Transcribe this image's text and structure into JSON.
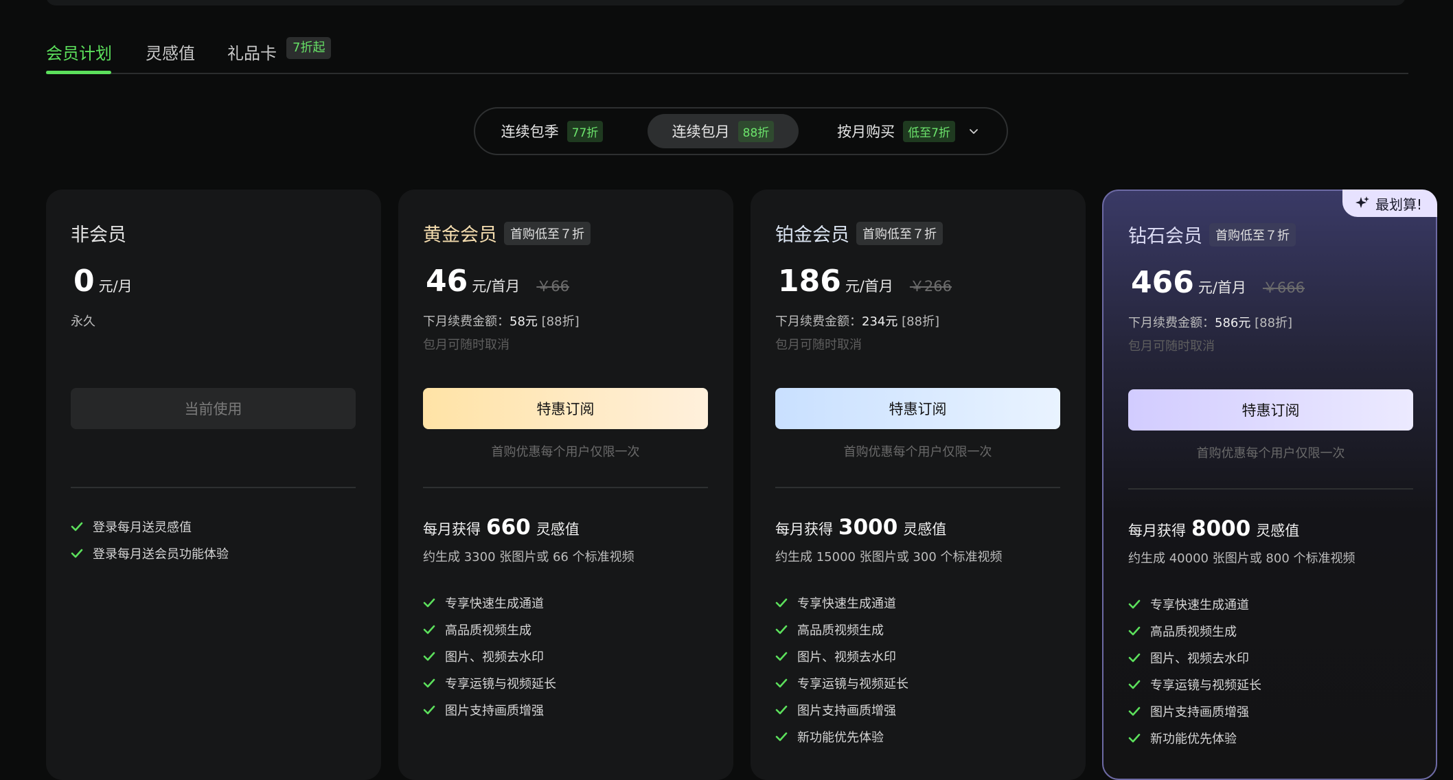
{
  "tabs": [
    {
      "label": "会员计划"
    },
    {
      "label": "灵感值"
    },
    {
      "label": "礼品卡",
      "badge": "7折起"
    }
  ],
  "billing": [
    {
      "label": "连续包季",
      "badge": "77折"
    },
    {
      "label": "连续包月",
      "badge": "88折"
    },
    {
      "label": "按月购买",
      "badge": "低至7折"
    }
  ],
  "plans": [
    {
      "name": "非会员",
      "price": "0",
      "unit": "元/月",
      "period": "永久",
      "button": "当前使用",
      "features": [
        "登录每月送灵感值",
        "登录每月送会员功能体验"
      ]
    },
    {
      "name": "黄金会员",
      "tag": "首购低至７折",
      "price": "46",
      "unit": "元/首月",
      "original": "￥66",
      "renew_label": "下月续费金额：",
      "renew_amount": "58元",
      "renew_discount": "[88折]",
      "cancel_note": "包月可随时取消",
      "button": "特惠订阅",
      "note": "首购优惠每个用户仅限一次",
      "credits_prefix": "每月获得",
      "credits": "660",
      "credits_suffix": "灵感值",
      "approx": "约生成 3300 张图片或 66 个标准视频",
      "features": [
        "专享快速生成通道",
        "高品质视频生成",
        "图片、视频去水印",
        "专享运镜与视频延长",
        "图片支持画质增强"
      ]
    },
    {
      "name": "铂金会员",
      "tag": "首购低至７折",
      "price": "186",
      "unit": "元/首月",
      "original": "￥266",
      "renew_label": "下月续费金额：",
      "renew_amount": "234元",
      "renew_discount": "[88折]",
      "cancel_note": "包月可随时取消",
      "button": "特惠订阅",
      "note": "首购优惠每个用户仅限一次",
      "credits_prefix": "每月获得",
      "credits": "3000",
      "credits_suffix": "灵感值",
      "approx": "约生成 15000 张图片或 300 个标准视频",
      "features": [
        "专享快速生成通道",
        "高品质视频生成",
        "图片、视频去水印",
        "专享运镜与视频延长",
        "图片支持画质增强",
        "新功能优先体验"
      ]
    },
    {
      "name": "钻石会员",
      "tag": "首购低至７折",
      "ribbon": "最划算!",
      "price": "466",
      "unit": "元/首月",
      "original": "￥666",
      "renew_label": "下月续费金额：",
      "renew_amount": "586元",
      "renew_discount": "[88折]",
      "cancel_note": "包月可随时取消",
      "button": "特惠订阅",
      "note": "首购优惠每个用户仅限一次",
      "credits_prefix": "每月获得",
      "credits": "8000",
      "credits_suffix": "灵感值",
      "approx": "约生成 40000 张图片或 800 个标准视频",
      "features": [
        "专享快速生成通道",
        "高品质视频生成",
        "图片、视频去水印",
        "专享运镜与视频延长",
        "图片支持画质增强",
        "新功能优先体验"
      ]
    }
  ],
  "colors": {
    "accent": "#5ce05c",
    "background": "#0b0c0c",
    "card": "#161718"
  }
}
